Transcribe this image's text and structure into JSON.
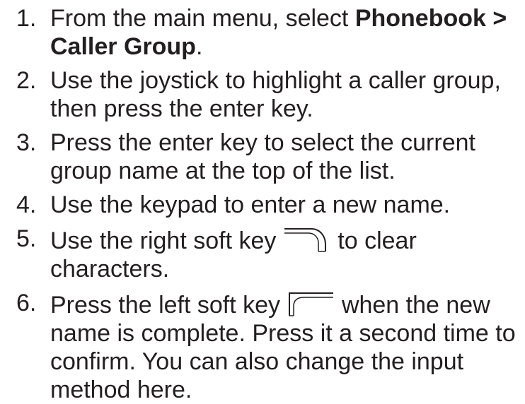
{
  "steps": [
    {
      "num": "1.",
      "pre": "From the main menu, select ",
      "bold": "Phonebook > Caller Group",
      "post": "."
    },
    {
      "num": "2.",
      "text": "Use the joystick to highlight a caller group, then press the enter key."
    },
    {
      "num": "3.",
      "text": "Press the enter key to select the current group name at the top of the list."
    },
    {
      "num": "4.",
      "text": "Use the keypad to enter a new name."
    },
    {
      "num": "5.",
      "pre": "Use the right soft key",
      "icon": "right-soft-key-icon",
      "post": "to clear characters."
    },
    {
      "num": "6.",
      "pre": "Press the left soft key",
      "icon": "left-soft-key-icon",
      "post": "when the new name is complete. Press it a second time to confirm. You can also change the input method here."
    }
  ]
}
